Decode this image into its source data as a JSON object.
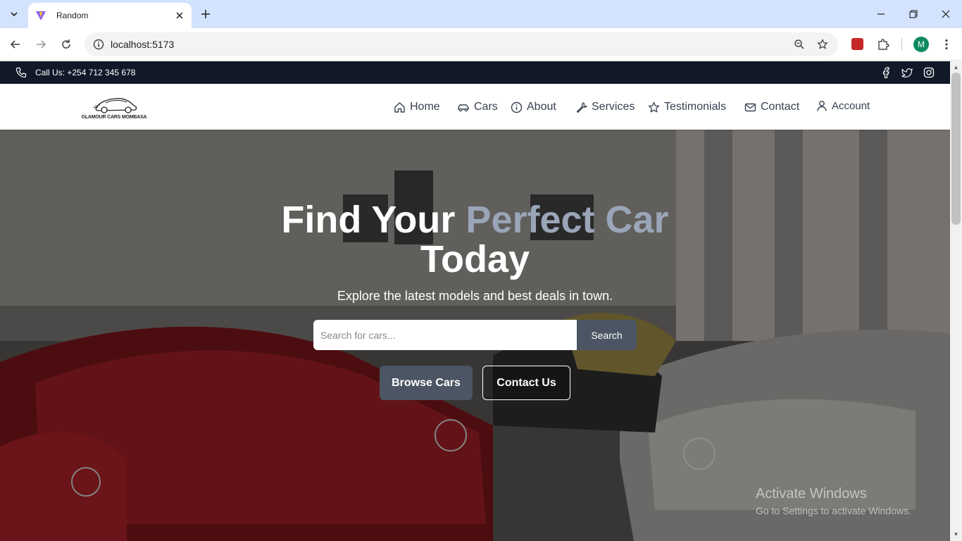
{
  "browser": {
    "tab_title": "Random",
    "url": "localhost:5173",
    "profile_initial": "M"
  },
  "topbar": {
    "call_text": "Call Us: +254 712 345 678"
  },
  "nav": {
    "logo_text": "GLAMOUR CARS MOMBASA",
    "items": [
      {
        "label": "Home",
        "icon": "home-icon"
      },
      {
        "label": "Cars",
        "icon": "car-icon"
      },
      {
        "label": "About",
        "icon": "info-icon"
      },
      {
        "label": "Services",
        "icon": "wrench-icon"
      },
      {
        "label": "Testimonials",
        "icon": "star-icon"
      },
      {
        "label": "Contact",
        "icon": "mail-icon"
      }
    ],
    "account_label": "Account"
  },
  "hero": {
    "title_part1": "Find Your",
    "title_accent": "Perfect Car",
    "title_part2": "Today",
    "subtitle": "Explore the latest models and best deals in town.",
    "search_placeholder": "Search for cars...",
    "search_button": "Search",
    "browse_button": "Browse Cars",
    "contact_button": "Contact Us"
  },
  "watermark": {
    "title": "Activate Windows",
    "subtitle": "Go to Settings to activate Windows."
  },
  "colors": {
    "topbar_bg": "#111827",
    "accent_text": "#9aa5b8",
    "primary_button": "#4b5563"
  }
}
